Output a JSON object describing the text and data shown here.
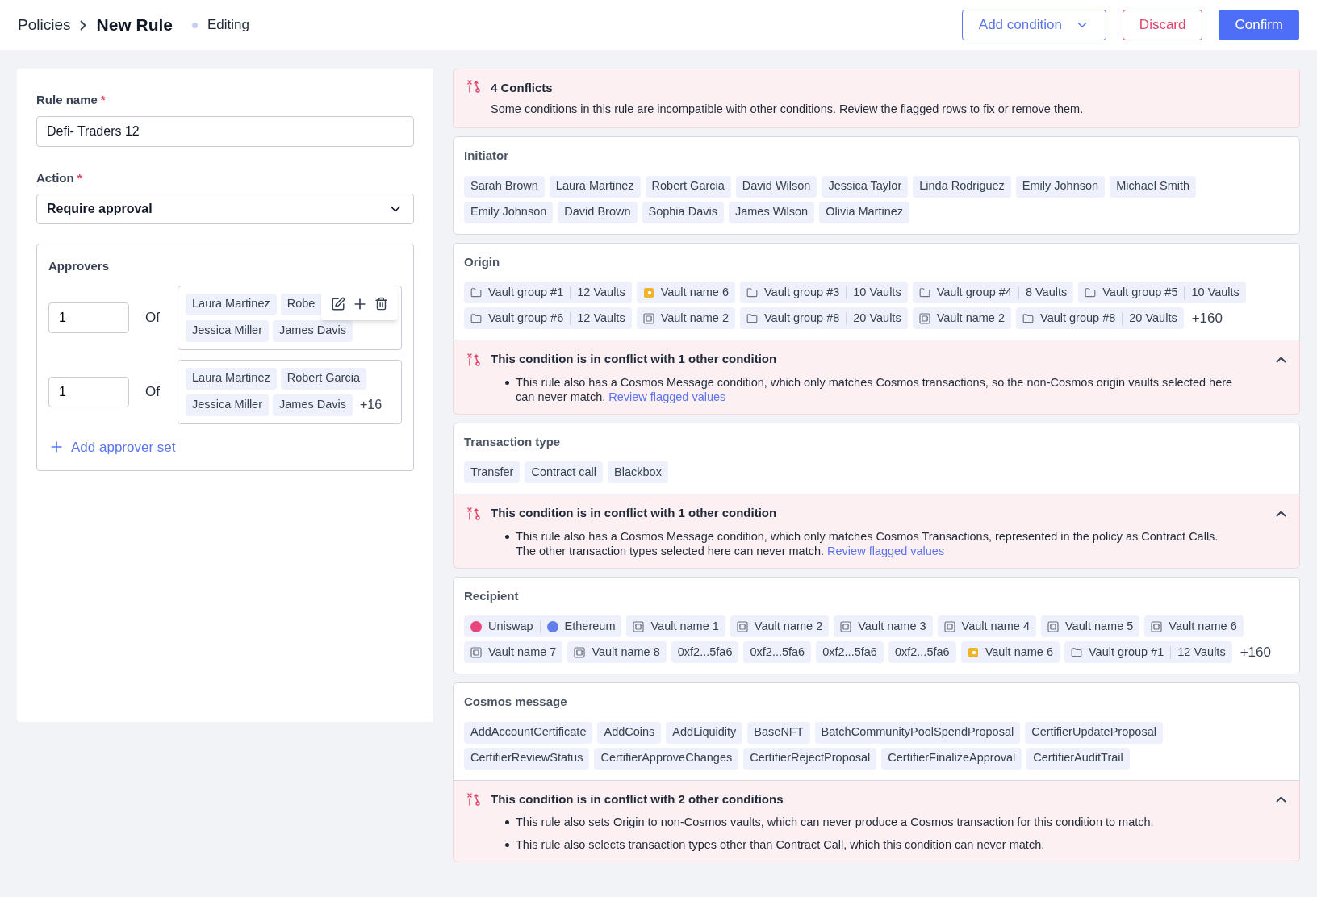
{
  "header": {
    "breadcrumb": [
      "Policies",
      "New Rule"
    ],
    "status": "Editing",
    "add_condition": "Add condition",
    "discard": "Discard",
    "confirm": "Confirm"
  },
  "form": {
    "rule_name": {
      "label": "Rule name",
      "required_mark": "*",
      "value": "Defi- Traders 12"
    },
    "action": {
      "label": "Action",
      "required_mark": "*",
      "value": "Require approval"
    },
    "approvers": {
      "title": "Approvers",
      "add_label": "Add approver set",
      "sets": [
        {
          "count": "1",
          "of_label": "Of",
          "rows": [
            [
              "Laura Martinez",
              "Robe"
            ],
            [
              "Jessica Miller",
              "James Davis"
            ]
          ],
          "toolbar": true
        },
        {
          "count": "1",
          "of_label": "Of",
          "rows": [
            [
              "Laura Martinez",
              "Robert Garcia"
            ],
            [
              "Jessica Miller",
              "James Davis"
            ]
          ],
          "more": "+16",
          "toolbar": false
        }
      ]
    }
  },
  "summary": {
    "title": "4 Conflicts",
    "text": "Some conditions in this rule are incompatible with other conditions. Review the flagged rows to fix or remove them."
  },
  "conditions": [
    {
      "title": "Initiator",
      "chips": [
        {
          "kind": "plain",
          "label": "Sarah Brown"
        },
        {
          "kind": "plain",
          "label": "Laura Martinez"
        },
        {
          "kind": "plain",
          "label": "Robert Garcia"
        },
        {
          "kind": "plain",
          "label": "David Wilson"
        },
        {
          "kind": "plain",
          "label": "Jessica Taylor"
        },
        {
          "kind": "plain",
          "label": "Linda Rodriguez"
        },
        {
          "kind": "plain",
          "label": "Emily Johnson"
        },
        {
          "kind": "plain",
          "label": "Michael Smith"
        },
        {
          "kind": "plain",
          "label": "Emily Johnson"
        },
        {
          "kind": "plain",
          "label": "David Brown"
        },
        {
          "kind": "plain",
          "label": "Sophia Davis"
        },
        {
          "kind": "plain",
          "label": "James Wilson"
        },
        {
          "kind": "plain",
          "label": "Olivia Martinez"
        }
      ]
    },
    {
      "title": "Origin",
      "chips": [
        {
          "kind": "group",
          "label": "Vault group #1",
          "count": "12 Vaults"
        },
        {
          "kind": "wallet",
          "label": "Vault name 6"
        },
        {
          "kind": "group",
          "label": "Vault group #3",
          "count": "10 Vaults"
        },
        {
          "kind": "group",
          "label": "Vault group #4",
          "count": "8 Vaults"
        },
        {
          "kind": "group",
          "label": "Vault group #5",
          "count": "10 Vaults"
        },
        {
          "kind": "group",
          "label": "Vault group #6",
          "count": "12 Vaults"
        },
        {
          "kind": "vault",
          "label": "Vault name 2"
        },
        {
          "kind": "group",
          "label": "Vault group #8",
          "count": "20 Vaults"
        },
        {
          "kind": "vault",
          "label": "Vault name 2"
        },
        {
          "kind": "group",
          "label": "Vault group #8",
          "count": "20 Vaults"
        }
      ],
      "more": "+160",
      "conflict": {
        "title": "This condition is in conflict with 1 other condition",
        "expanded": true,
        "bullets": [
          {
            "text": "This rule also has a Cosmos Message condition, which only matches Cosmos transactions, so the non-Cosmos origin vaults selected here can never match.",
            "link": "Review flagged values"
          }
        ]
      }
    },
    {
      "title": "Transaction type",
      "chips": [
        {
          "kind": "plain",
          "label": "Transfer"
        },
        {
          "kind": "plain",
          "label": "Contract call"
        },
        {
          "kind": "plain",
          "label": "Blackbox"
        }
      ],
      "conflict": {
        "title": "This condition is in conflict with 1 other condition",
        "expanded": true,
        "bullets": [
          {
            "text": "This rule also has a Cosmos Message condition, which only matches Cosmos Transactions, represented in the policy as Contract Calls. The other transaction types selected here can never match.",
            "link": "Review flagged values"
          }
        ]
      }
    },
    {
      "title": "Recipient",
      "chips": [
        {
          "kind": "pair",
          "parts": [
            {
              "label": "Uniswap",
              "color": "#e8467c"
            },
            {
              "label": "Ethereum",
              "color": "#627eea"
            }
          ]
        },
        {
          "kind": "vault",
          "label": "Vault name 1"
        },
        {
          "kind": "vault",
          "label": "Vault name 2"
        },
        {
          "kind": "vault",
          "label": "Vault name 3"
        },
        {
          "kind": "vault",
          "label": "Vault name 4"
        },
        {
          "kind": "vault",
          "label": "Vault name 5"
        },
        {
          "kind": "vault",
          "label": "Vault name 6"
        },
        {
          "kind": "vault",
          "label": "Vault name 7"
        },
        {
          "kind": "vault",
          "label": "Vault name 8"
        },
        {
          "kind": "plain",
          "label": "0xf2...5fa6"
        },
        {
          "kind": "plain",
          "label": "0xf2...5fa6"
        },
        {
          "kind": "plain",
          "label": "0xf2...5fa6"
        },
        {
          "kind": "plain",
          "label": "0xf2...5fa6"
        },
        {
          "kind": "wallet",
          "label": "Vault name 6"
        },
        {
          "kind": "group",
          "label": "Vault group #1",
          "count": "12 Vaults"
        }
      ],
      "more": "+160"
    },
    {
      "title": "Cosmos message",
      "chips": [
        {
          "kind": "plain",
          "label": "AddAccountCertificate"
        },
        {
          "kind": "plain",
          "label": "AddCoins"
        },
        {
          "kind": "plain",
          "label": "AddLiquidity"
        },
        {
          "kind": "plain",
          "label": "BaseNFT"
        },
        {
          "kind": "plain",
          "label": "BatchCommunityPoolSpendProposal"
        },
        {
          "kind": "plain",
          "label": "CertifierUpdateProposal"
        },
        {
          "kind": "plain",
          "label": "CertifierReviewStatus"
        },
        {
          "kind": "plain",
          "label": "CertifierApproveChanges"
        },
        {
          "kind": "plain",
          "label": "CertifierRejectProposal"
        },
        {
          "kind": "plain",
          "label": "CertifierFinalizeApproval"
        },
        {
          "kind": "plain",
          "label": "CertifierAuditTrail"
        }
      ],
      "conflict": {
        "title": "This condition is in conflict with 2 other conditions",
        "expanded": true,
        "bullets": [
          {
            "text": "This rule also sets Origin to non-Cosmos vaults, which can never produce a Cosmos transaction for this condition to match."
          },
          {
            "text": "This rule also selects transaction types other than Contract Call, which this condition can never match."
          }
        ]
      }
    }
  ]
}
